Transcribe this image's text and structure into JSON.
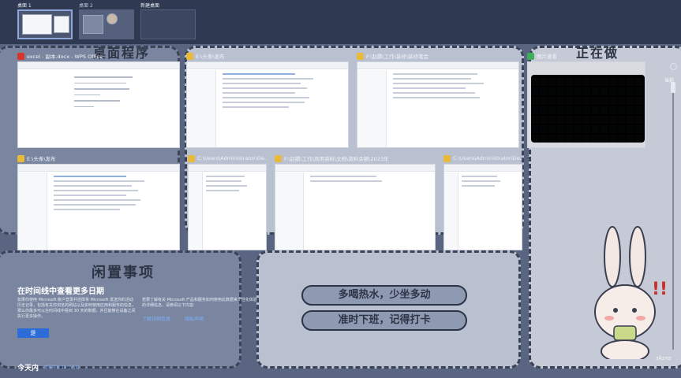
{
  "desktops": [
    {
      "label": "桌面 1",
      "active": true
    },
    {
      "label": "桌面 2",
      "active": false
    },
    {
      "label": "新建桌面",
      "active": false
    }
  ],
  "wallpaper": {
    "title_top_left": "桌面程序",
    "title_top_right": "正在做",
    "title_mid_left": "闲置事项",
    "pill_1": "多喝热水，少坐多动",
    "pill_2": "准时下班，记得打卡"
  },
  "windows": [
    {
      "title": "excel - 副本.docx - WPS Office",
      "icon": "wps-icon",
      "icon_color": "#d9342b"
    },
    {
      "title": "E:\\头条\\发布",
      "icon": "folder-icon",
      "icon_color": "#e8b93a"
    },
    {
      "title": "F:\\赵鹏\\工作\\装修\\装修笔会",
      "icon": "folder-icon",
      "icon_color": "#e8b93a"
    },
    {
      "title": "图片查看",
      "icon": "photos-icon",
      "icon_color": "#3fae5a"
    },
    {
      "title": "E:\\头条\\发布",
      "icon": "folder-icon",
      "icon_color": "#e8b93a"
    },
    {
      "title": "C:\\Users\\Administrator\\De...",
      "icon": "folder-icon",
      "icon_color": "#e8b93a"
    },
    {
      "title": "F:\\赵鹏\\工作\\商用资料\\文档\\资料余额\\2023年",
      "icon": "folder-icon",
      "icon_color": "#e8b93a"
    },
    {
      "title": "C:\\Users\\Administrator\\De...",
      "icon": "folder-icon",
      "icon_color": "#e8b93a"
    }
  ],
  "timeline": {
    "title": "在时间线中查看更多日期",
    "left_text": "如果你使用 Microsoft 帐户登录并选择将 Microsoft 发送你的活动历史记录，包括有关你浏览的网站以及如何使用应用和服务的信息，那么你最多可以在时间线中看到 30 天的数据。并且能够在设备之间执行更多操作。",
    "right_text": "若要了解有关 Microsoft 产品和服务如何使用此数据来个性化体验的详细信息，请参阅以下内容:",
    "yes_button": "是",
    "link_learn_more": "了解详细信息",
    "link_privacy": "隐私声明",
    "today_label": "今天内",
    "today_sub": "查看所有 19 个活动"
  },
  "scroll": {
    "label": "当前"
  },
  "corner_date": "3月27日"
}
